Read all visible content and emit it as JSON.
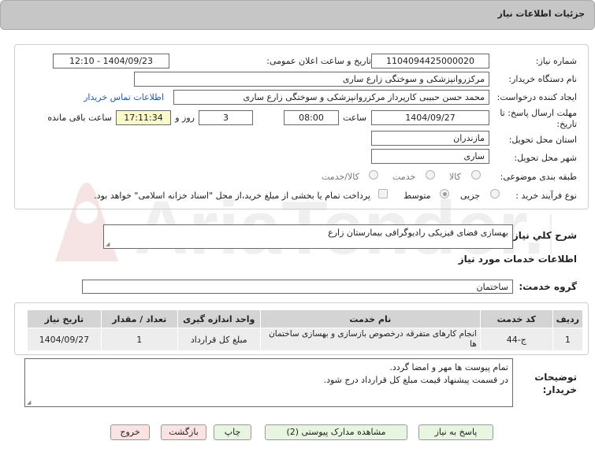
{
  "header": {
    "title": "جزئیات اطلاعات نیاز"
  },
  "form": {
    "need_number_label": "شماره نیاز:",
    "need_number": "1104094425000020",
    "announce_label": "تاریخ و ساعت اعلان عمومی:",
    "announce_value": "1404/09/23 - 12:10",
    "buyer_org_label": "نام دستگاه خریدار:",
    "buyer_org": "مرکزروانپزشکی و سوختگی زارع ساری",
    "creator_label": "ایجاد کننده درخواست:",
    "creator": "محمد حسن حبیبی کارپرداز مرکزروانپزشکی و سوختگی زارع ساری",
    "contact_link": "اطلاعات تماس خریدار",
    "deadline_label_1": "مهلت ارسال پاسخ: تا",
    "deadline_label_2": "تاریخ:",
    "deadline_date": "1404/09/27",
    "time_label": "ساعت",
    "deadline_time": "08:00",
    "days_value": "3",
    "days_label": "روز و",
    "remaining_time": "17:11:34",
    "remaining_label": "ساعت باقی مانده",
    "province_label": "استان محل تحویل:",
    "province": "مازندران",
    "city_label": "شهر محل تحویل:",
    "city": "ساری",
    "category_label": "طبقه بندی موضوعی:",
    "category_options": [
      "کالا",
      "خدمت",
      "کالا/خدمت"
    ],
    "process_label": "نوع فرآیند خرید :",
    "process_options": [
      "جزیی",
      "متوسط"
    ],
    "payment_note": "پرداخت تمام یا بخشی از مبلغ خرید،از محل \"اسناد خزانه اسلامی\" خواهد بود."
  },
  "summary": {
    "label": "شرح کلي نياز:",
    "value": "بهسازی فضای فیزیکی رادیوگرافی بیمارستان زارع"
  },
  "services": {
    "section_title": "اطلاعات خدمات مورد نیاز",
    "group_label": "گروه خدمت:",
    "group_value": "ساختمان",
    "columns": [
      "ردیف",
      "کد خدمت",
      "نام خدمت",
      "واحد اندازه گیری",
      "تعداد / مقدار",
      "تاریخ نیاز"
    ],
    "rows": [
      {
        "row": "1",
        "code": "ج-44",
        "name": "انجام کارهای متفرقه درخصوص بازسازی و بهسازی ساختمان ها",
        "unit": "مبلغ کل قرارداد",
        "qty": "1",
        "date": "1404/09/27"
      }
    ]
  },
  "buyer_notes": {
    "label_1": "توضیحات",
    "label_2": "خریدار:",
    "line_1": "تمام پیوست ها مهر و امضا گردد.",
    "line_2": "در قسمت پیشنهاد قیمت مبلغ کل قرارداد درج شود."
  },
  "buttons": {
    "reply": "پاسخ به نیاز",
    "attachments": "مشاهده مدارک پیوستی (2)",
    "print": "چاپ",
    "back": "بازگشت",
    "exit": "خروج"
  },
  "watermark": {
    "text": "AriaTender.neT"
  },
  "colors": {
    "header_bg": "#c6c6c6",
    "highlight_yellow": "#fafac8",
    "button_green": "#e8f5e0",
    "button_red": "#fbe3e3",
    "link": "#2255cc"
  }
}
